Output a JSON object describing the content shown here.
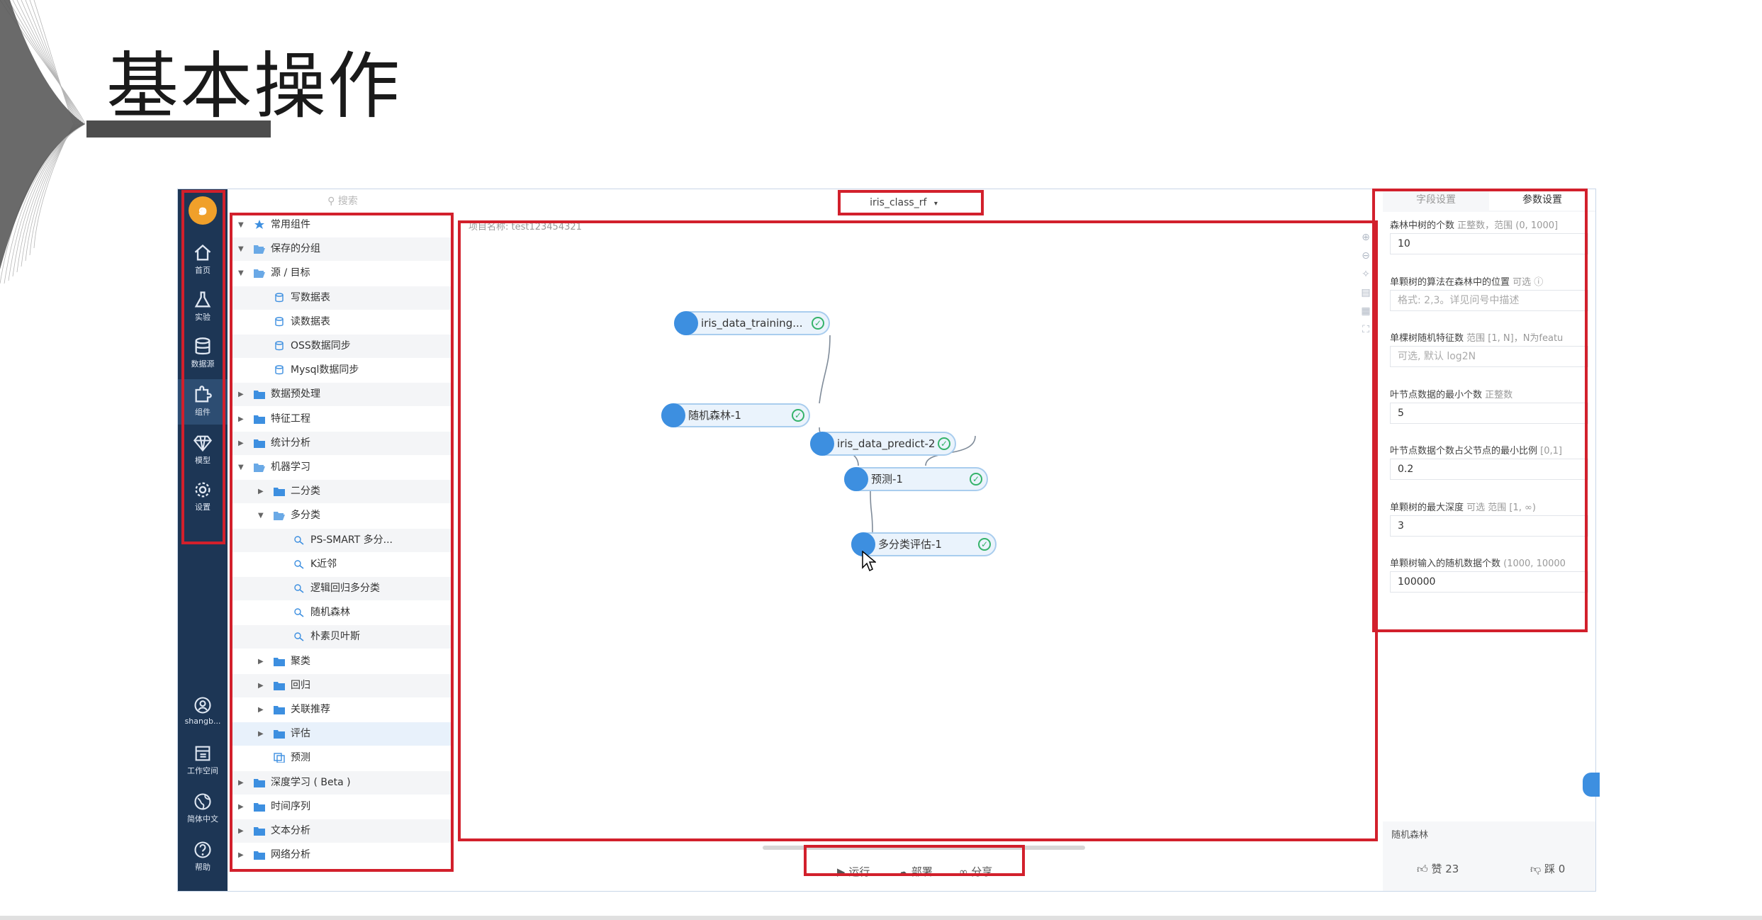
{
  "slide": {
    "title": "基本操作"
  },
  "app": {
    "logo_text": "๑",
    "nav": [
      {
        "label": "首页",
        "icon": "home-icon"
      },
      {
        "label": "实验",
        "icon": "flask-icon"
      },
      {
        "label": "数据源",
        "icon": "database-icon"
      },
      {
        "label": "组件",
        "icon": "puzzle-icon"
      },
      {
        "label": "模型",
        "icon": "diamond-icon"
      },
      {
        "label": "设置",
        "icon": "gear-icon"
      }
    ],
    "nav_bottom": [
      {
        "label": "shangb...",
        "icon": "user-icon"
      },
      {
        "label": "工作空间",
        "icon": "workspace-icon"
      },
      {
        "label": "简体中文",
        "icon": "globe-icon"
      },
      {
        "label": "帮助",
        "icon": "help-icon"
      }
    ],
    "search_placeholder": "搜索",
    "tree": [
      {
        "label": "常用组件",
        "level": 0,
        "caret": "down",
        "type": "star"
      },
      {
        "label": "保存的分组",
        "level": 0,
        "caret": "down",
        "type": "folder-open"
      },
      {
        "label": "源 / 目标",
        "level": 0,
        "caret": "down",
        "type": "folder-open"
      },
      {
        "label": "写数据表",
        "level": 1,
        "caret": "",
        "type": "db"
      },
      {
        "label": "读数据表",
        "level": 1,
        "caret": "",
        "type": "db"
      },
      {
        "label": "OSS数据同步",
        "level": 1,
        "caret": "",
        "type": "db"
      },
      {
        "label": "Mysql数据同步",
        "level": 1,
        "caret": "",
        "type": "db"
      },
      {
        "label": "数据预处理",
        "level": 0,
        "caret": "right",
        "type": "folder"
      },
      {
        "label": "特征工程",
        "level": 0,
        "caret": "right",
        "type": "folder"
      },
      {
        "label": "统计分析",
        "level": 0,
        "caret": "right",
        "type": "folder"
      },
      {
        "label": "机器学习",
        "level": 0,
        "caret": "down",
        "type": "folder-open"
      },
      {
        "label": "二分类",
        "level": 1,
        "caret": "right",
        "type": "folder"
      },
      {
        "label": "多分类",
        "level": 1,
        "caret": "down",
        "type": "folder-open"
      },
      {
        "label": "PS-SMART 多分...",
        "level": 2,
        "caret": "",
        "type": "algo"
      },
      {
        "label": "K近邻",
        "level": 2,
        "caret": "",
        "type": "algo"
      },
      {
        "label": "逻辑回归多分类",
        "level": 2,
        "caret": "",
        "type": "algo"
      },
      {
        "label": "随机森林",
        "level": 2,
        "caret": "",
        "type": "algo"
      },
      {
        "label": "朴素贝叶斯",
        "level": 2,
        "caret": "",
        "type": "algo"
      },
      {
        "label": "聚类",
        "level": 1,
        "caret": "right",
        "type": "folder"
      },
      {
        "label": "回归",
        "level": 1,
        "caret": "right",
        "type": "folder"
      },
      {
        "label": "关联推荐",
        "level": 1,
        "caret": "right",
        "type": "folder"
      },
      {
        "label": "评估",
        "level": 1,
        "caret": "right",
        "type": "folder"
      },
      {
        "label": "预测",
        "level": 1,
        "caret": "",
        "type": "predict"
      },
      {
        "label": "深度学习 ( Beta )",
        "level": 0,
        "caret": "right",
        "type": "folder"
      },
      {
        "label": "时间序列",
        "level": 0,
        "caret": "right",
        "type": "folder"
      },
      {
        "label": "文本分析",
        "level": 0,
        "caret": "right",
        "type": "folder"
      },
      {
        "label": "网络分析",
        "level": 0,
        "caret": "right",
        "type": "folder"
      }
    ],
    "workflow_tab": "iris_class_rf",
    "project_name": "项目名称: test123454321",
    "canvas_tools": [
      "zoom-in-icon",
      "zoom-out-icon",
      "fit-icon",
      "minimap-icon",
      "select-icon",
      "fullscreen-icon"
    ],
    "nodes": [
      {
        "id": "n1",
        "label": "iris_data_training..."
      },
      {
        "id": "n2",
        "label": "随机森林-1"
      },
      {
        "id": "n3",
        "label": "iris_data_predict-2"
      },
      {
        "id": "n4",
        "label": "预测-1"
      },
      {
        "id": "n5",
        "label": "多分类评估-1"
      }
    ],
    "actions": [
      {
        "label": "运行",
        "icon": "play-icon"
      },
      {
        "label": "部署",
        "icon": "cloud-upload-icon"
      },
      {
        "label": "分享",
        "icon": "share-icon"
      }
    ],
    "panel": {
      "tabs": [
        "字段设置",
        "参数设置"
      ],
      "params": [
        {
          "label": "森林中树的个数",
          "hint": "正整数，范围 (0, 1000]",
          "value": "10",
          "placeholder": false
        },
        {
          "label": "单颗树的算法在森林中的位置",
          "hint": "可选 ⓘ",
          "value": "格式: 2,3。详见问号中描述",
          "placeholder": true
        },
        {
          "label": "单棵树随机特征数",
          "hint": "范围 [1, N]，N为featu",
          "value": "可选, 默认 log2N",
          "placeholder": true
        },
        {
          "label": "叶节点数据的最小个数",
          "hint": "正整数",
          "value": "5",
          "placeholder": false
        },
        {
          "label": "叶节点数据个数占父节点的最小比例",
          "hint": "[0,1]",
          "value": "0.2",
          "placeholder": false
        },
        {
          "label": "单颗树的最大深度",
          "hint": "可选 范围 [1, ∞)",
          "value": "3",
          "placeholder": false
        },
        {
          "label": "单颗树输入的随机数据个数",
          "hint": "(1000, 10000",
          "value": "100000",
          "placeholder": false
        }
      ],
      "algorithm": "随机森林",
      "likes": "赞 23",
      "dislikes": "踩 0"
    }
  },
  "colors": {
    "highlight": "#d2202c",
    "nav": "#1d3655",
    "accent": "#3d8fe0",
    "ok": "#35b36a"
  }
}
